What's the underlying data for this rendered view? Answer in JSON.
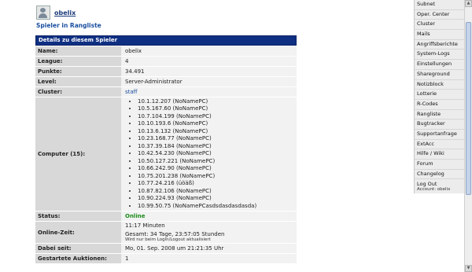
{
  "header": {
    "username": "obelix",
    "rank_link": "Spieler in Rangliste"
  },
  "details": {
    "title": "Details zu diesem Spieler",
    "name_label": "Name:",
    "name_value": "obelix",
    "league_label": "League:",
    "league_value": "4",
    "points_label": "Punkte:",
    "points_value": "34.491",
    "level_label": "Level:",
    "level_value": "Server-Administrator",
    "cluster_label": "Cluster:",
    "cluster_value": "staff",
    "computers_label": "Computer (15):",
    "computers": [
      "10.1.12.207 (NoNamePC)",
      "10.5.167.60 (NoNamePC)",
      "10.7.104.199 (NoNamePC)",
      "10.10.193.6 (NoNamePC)",
      "10.13.6.132 (NoNamePC)",
      "10.23.168.77 (NoNamePC)",
      "10.37.39.184 (NoNamePC)",
      "10.42.54.230 (NoNamePC)",
      "10.50.127.221 (NoNamePC)",
      "10.66.242.90 (NoNamePC)",
      "10.75.201.238 (NoNamePC)",
      "10.77.24.216 (üöäß)",
      "10.87.82.106 (NoNamePC)",
      "10.90.224.93 (NoNamePC)",
      "10.99.50.75 (NoNamePCasdsdasdasdasda)"
    ],
    "status_label": "Status:",
    "status_value": "Online",
    "online_label": "Online-Zeit:",
    "online_value": "11:17 Minuten",
    "online_total": "Gesamt: 34 Tage, 23:57:05 Stunden",
    "online_note": "Wird nur beim Login/Logout aktualisiert",
    "since_label": "Dabei seit:",
    "since_value": "Mo, 01. Sep. 2008 um 21:21:35 Uhr",
    "auctions_label": "Gestartete Auktionen:",
    "auctions_value": "1"
  },
  "nav": {
    "items": [
      "Subnet",
      "Oper. Center",
      "Cluster",
      "Mails",
      "Angriffsberichte",
      "System-Logs",
      "Einstellungen",
      "Shareground",
      "Notizblock",
      "Lotterie",
      "R-Codes",
      "Rangliste",
      "Bugtracker",
      "Supportanfrage",
      "ExtAcc",
      "Hilfe / Wiki",
      "Forum",
      "Changelog"
    ],
    "logout": "Log Out",
    "account": "Account: obelix"
  }
}
